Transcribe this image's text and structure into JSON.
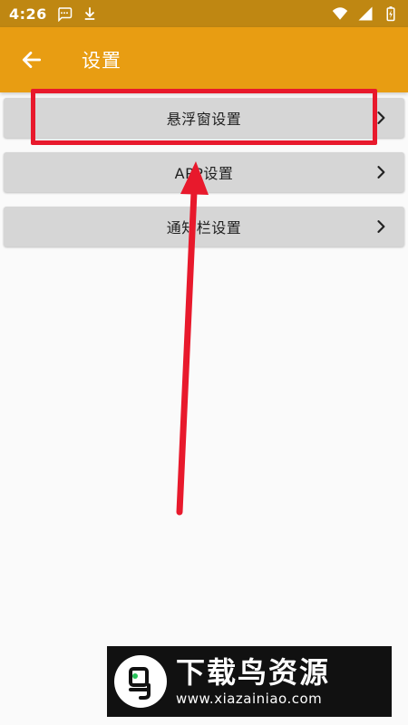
{
  "status_bar": {
    "time": "4:26",
    "left_icons": [
      "chat-bubble-icon",
      "download-icon"
    ],
    "right_icons": [
      "wifi-icon",
      "signal-icon",
      "battery-icon"
    ]
  },
  "app_bar": {
    "title": "设置",
    "back_icon": "arrow-left-icon"
  },
  "settings": {
    "items": [
      {
        "label": "悬浮窗设置"
      },
      {
        "label": "APP设置"
      },
      {
        "label": "通知栏设置"
      }
    ]
  },
  "annotation": {
    "color": "#e8192c"
  },
  "watermark": {
    "title": "下载鸟资源",
    "url": "www.xiazainiao.com"
  },
  "colors": {
    "status_bar": "#bf8712",
    "app_bar": "#e89d12",
    "background": "#fafafa",
    "item_background": "#d6d6d6"
  }
}
